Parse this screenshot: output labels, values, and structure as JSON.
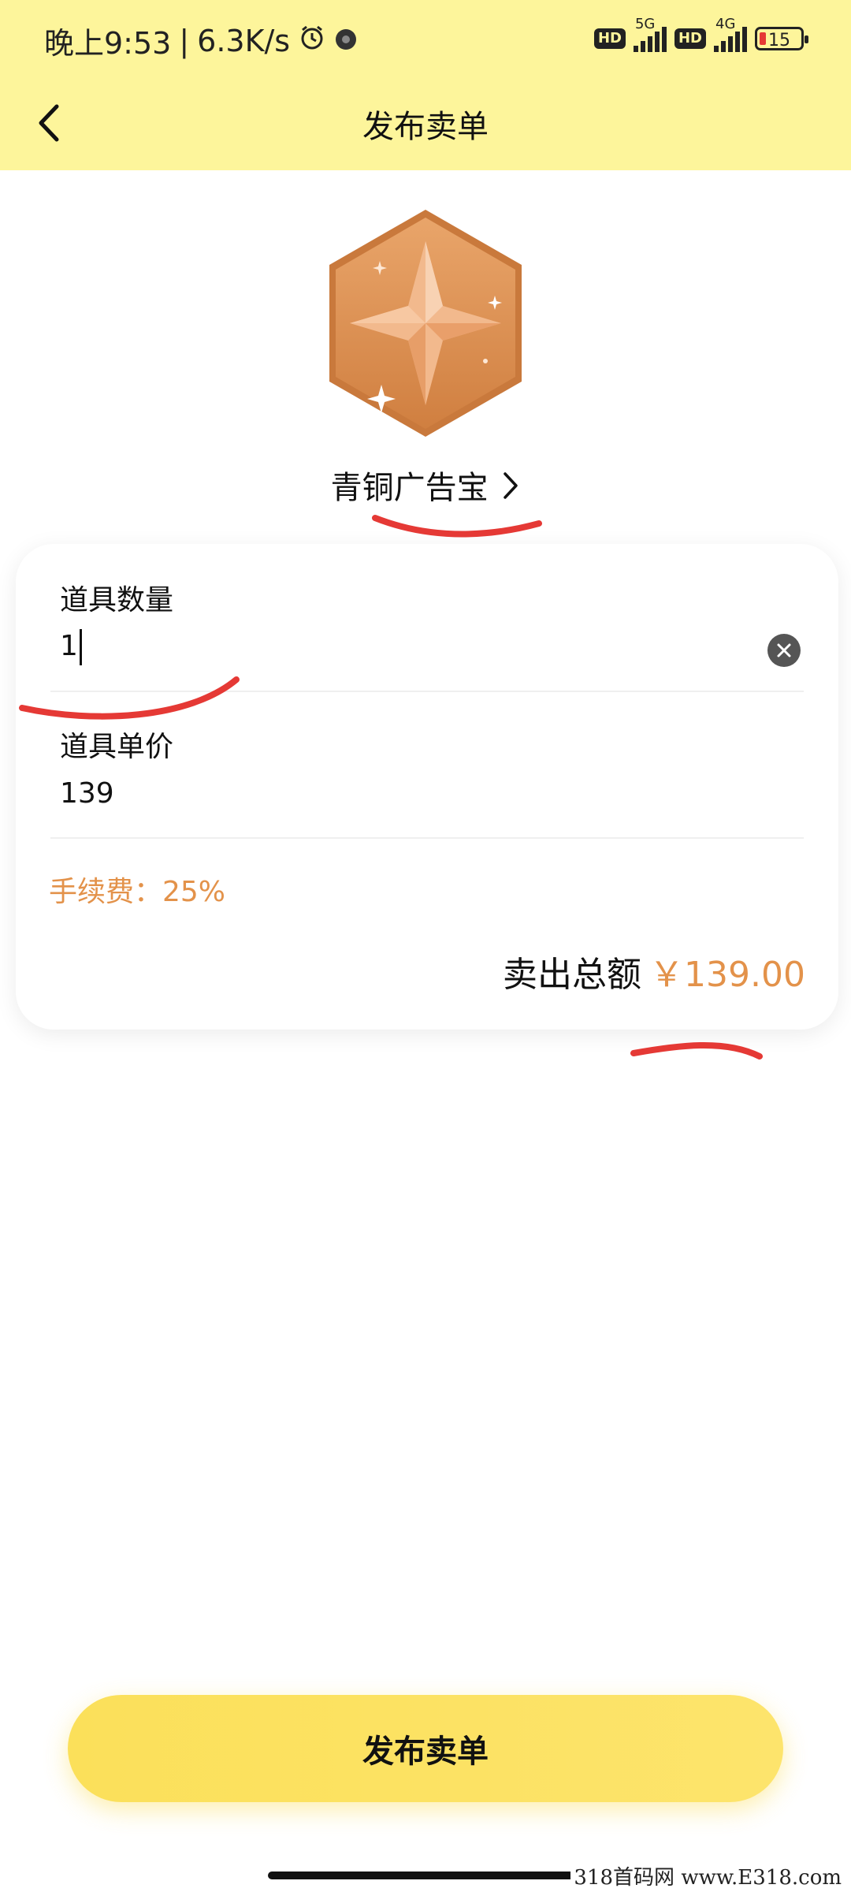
{
  "status_bar": {
    "time": "晚上9:53",
    "speed": "6.3K/s",
    "hd1": "HD",
    "net1": "5G",
    "hd2": "HD",
    "net2": "4G",
    "battery": "15"
  },
  "header": {
    "title": "发布卖单"
  },
  "item": {
    "name": "青铜广告宝",
    "badge_colors": {
      "hex": "#d9884a",
      "hex_light": "#e9a56a",
      "star": "#f6c7a3"
    }
  },
  "form": {
    "quantity_label": "道具数量",
    "quantity_value": "1",
    "price_label": "道具单价",
    "price_value": "139",
    "fee_text": "手续费：25%",
    "total_label": "卖出总额",
    "total_amount": "￥139.00"
  },
  "footer": {
    "publish_label": "发布卖单"
  },
  "watermark": "318首码网 www.E318.com",
  "colors": {
    "header_bg": "#fdf59b",
    "accent_orange": "#e3924a",
    "button_yellow": "#fbe05a",
    "annotation_red": "#e53935"
  }
}
